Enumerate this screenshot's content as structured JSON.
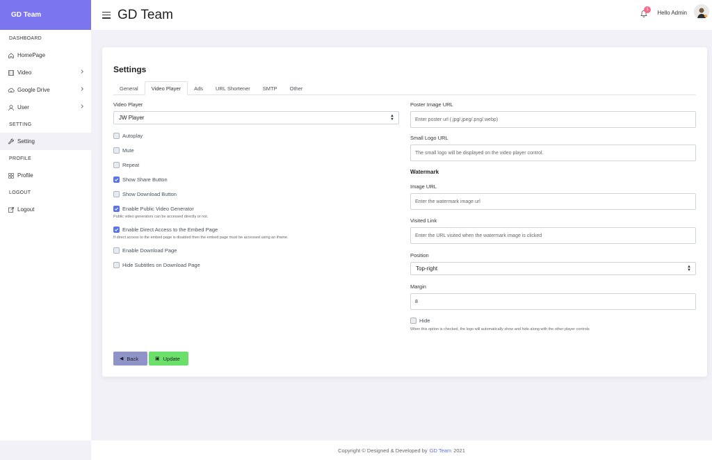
{
  "brand": "GD Team",
  "header": {
    "title": "GD Team",
    "notification_count": "1",
    "greeting": "Hello Admin"
  },
  "sidebar": {
    "sections": [
      {
        "title": "DASHBOARD",
        "items": [
          {
            "label": "HomePage",
            "icon": "home-icon",
            "chevron": false
          },
          {
            "label": "Video",
            "icon": "video-icon",
            "chevron": true
          },
          {
            "label": "Google Drive",
            "icon": "cloud-icon",
            "chevron": true
          },
          {
            "label": "User",
            "icon": "user-icon",
            "chevron": true
          }
        ]
      },
      {
        "title": "SETTING",
        "items": [
          {
            "label": "Setting",
            "icon": "wrench-icon",
            "chevron": false,
            "active": true
          }
        ]
      },
      {
        "title": "PROFILE",
        "items": [
          {
            "label": "Profile",
            "icon": "grid-icon",
            "chevron": false
          }
        ]
      },
      {
        "title": "LOGOUT",
        "items": [
          {
            "label": "Logout",
            "icon": "logout-icon",
            "chevron": false
          }
        ]
      }
    ]
  },
  "settings": {
    "title": "Settings",
    "tabs": [
      "General",
      "Video Player",
      "Ads",
      "URL Shortener",
      "SMTP",
      "Other"
    ],
    "active_tab": "Video Player",
    "video_player_label": "Video Player",
    "video_player_value": "JW Player",
    "checkboxes": [
      {
        "label": "Autoplay",
        "checked": false,
        "help": ""
      },
      {
        "label": "Mute",
        "checked": false,
        "help": ""
      },
      {
        "label": "Repeat",
        "checked": false,
        "help": ""
      },
      {
        "label": "Show Share Button",
        "checked": true,
        "help": ""
      },
      {
        "label": "Show Download Button",
        "checked": false,
        "help": ""
      },
      {
        "label": "Enable Public Video Generator",
        "checked": true,
        "help": "Public video generators can be accessed directly or not."
      },
      {
        "label": "Enable Direct Access to the Embed Page",
        "checked": true,
        "help": "If direct access to the embed page is disabled then the embed page must be accessed using an iframe."
      },
      {
        "label": "Enable Download Page",
        "checked": false,
        "help": ""
      },
      {
        "label": "Hide Subtitles on Download Page",
        "checked": false,
        "help": ""
      }
    ],
    "poster_label": "Poster Image URL",
    "poster_placeholder": "Enter poster url (.jpg/.jpeg/.png/.webp)",
    "small_logo_label": "Small Logo URL",
    "small_logo_placeholder": "The small logo will be displayed on the video player control.",
    "watermark_heading": "Watermark",
    "image_url_label": "Image URL",
    "image_url_placeholder": "Enter the watermark image url",
    "visited_link_label": "Visited Link",
    "visited_link_placeholder": "Enter the URL visited when the watermark image is clicked",
    "position_label": "Position",
    "position_value": "Top-right",
    "margin_label": "Margin",
    "margin_value": "8",
    "hide_label": "Hide",
    "hide_checked": false,
    "hide_help": "When this option is checked, the logo will automatically show and hide along with the other player controls",
    "back_label": "Back",
    "update_label": "Update"
  },
  "footer": {
    "prefix": "Copyright © Designed & Developed by",
    "link": "GD Team",
    "year": "2021"
  },
  "colors": {
    "brand": "#7b75f0",
    "accent": "#5b73e8",
    "update": "#6adf6a",
    "back": "#8f93c8",
    "badge": "#f46a8a"
  }
}
